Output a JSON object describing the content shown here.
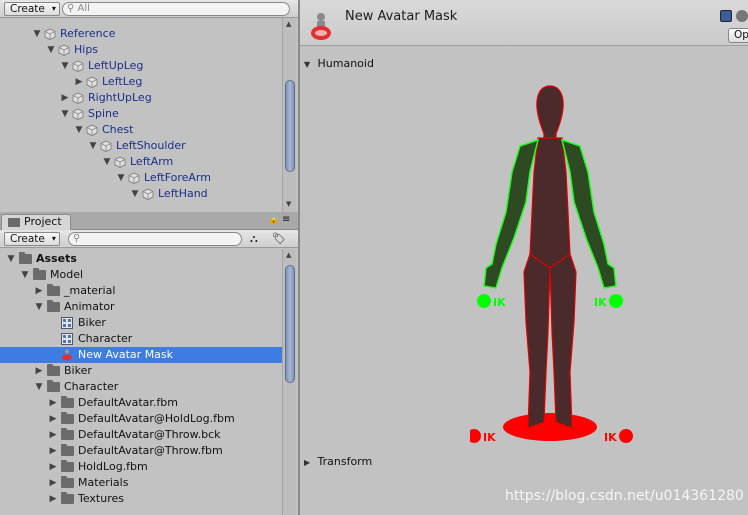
{
  "hierarchy": {
    "search_placeholder": "All",
    "create_label": "Create",
    "rows": [
      {
        "label": "Reference",
        "depth": 0,
        "expanded": true
      },
      {
        "label": "Hips",
        "depth": 1,
        "expanded": true
      },
      {
        "label": "LeftUpLeg",
        "depth": 2,
        "expanded": true
      },
      {
        "label": "LeftLeg",
        "depth": 3,
        "expanded": false
      },
      {
        "label": "RightUpLeg",
        "depth": 2,
        "expanded": false
      },
      {
        "label": "Spine",
        "depth": 2,
        "expanded": true
      },
      {
        "label": "Chest",
        "depth": 3,
        "expanded": true
      },
      {
        "label": "LeftShoulder",
        "depth": 4,
        "expanded": true
      },
      {
        "label": "LeftArm",
        "depth": 5,
        "expanded": true
      },
      {
        "label": "LeftForeArm",
        "depth": 6,
        "expanded": true
      },
      {
        "label": "LeftHand",
        "depth": 7,
        "expanded": true
      }
    ]
  },
  "project": {
    "tab_label": "Project",
    "create_label": "Create",
    "rows": [
      {
        "label": "Assets",
        "depth": 0,
        "type": "folder",
        "expanded": true,
        "bold": true
      },
      {
        "label": "Model",
        "depth": 1,
        "type": "folder",
        "expanded": true
      },
      {
        "label": "_material",
        "depth": 2,
        "type": "folder",
        "expanded": false
      },
      {
        "label": "Animator",
        "depth": 2,
        "type": "folder",
        "expanded": true
      },
      {
        "label": "Biker",
        "depth": 3,
        "type": "controller"
      },
      {
        "label": "Character",
        "depth": 3,
        "type": "controller"
      },
      {
        "label": "New Avatar Mask",
        "depth": 3,
        "type": "mask",
        "selected": true
      },
      {
        "label": "Biker",
        "depth": 2,
        "type": "folder",
        "expanded": false
      },
      {
        "label": "Character",
        "depth": 2,
        "type": "folder",
        "expanded": true
      },
      {
        "label": "DefaultAvatar.fbm",
        "depth": 3,
        "type": "folder",
        "expanded": false
      },
      {
        "label": "DefaultAvatar@HoldLog.fbm",
        "depth": 3,
        "type": "folder",
        "expanded": false
      },
      {
        "label": "DefaultAvatar@Throw.bck",
        "depth": 3,
        "type": "folder",
        "expanded": false
      },
      {
        "label": "DefaultAvatar@Throw.fbm",
        "depth": 3,
        "type": "folder",
        "expanded": false
      },
      {
        "label": "HoldLog.fbm",
        "depth": 3,
        "type": "folder",
        "expanded": false
      },
      {
        "label": "Materials",
        "depth": 3,
        "type": "folder",
        "expanded": false
      },
      {
        "label": "Textures",
        "depth": 3,
        "type": "folder",
        "expanded": false
      }
    ]
  },
  "inspector": {
    "title": "New Avatar Mask",
    "open_label": "Op",
    "humanoid_label": "Humanoid",
    "transform_label": "Transform",
    "ik_label": "IK",
    "colors": {
      "enabled": "#00ff00",
      "disabled": "#ff0000",
      "body": "#4a2a2a"
    }
  },
  "watermark": "https://blog.csdn.net/u014361280"
}
